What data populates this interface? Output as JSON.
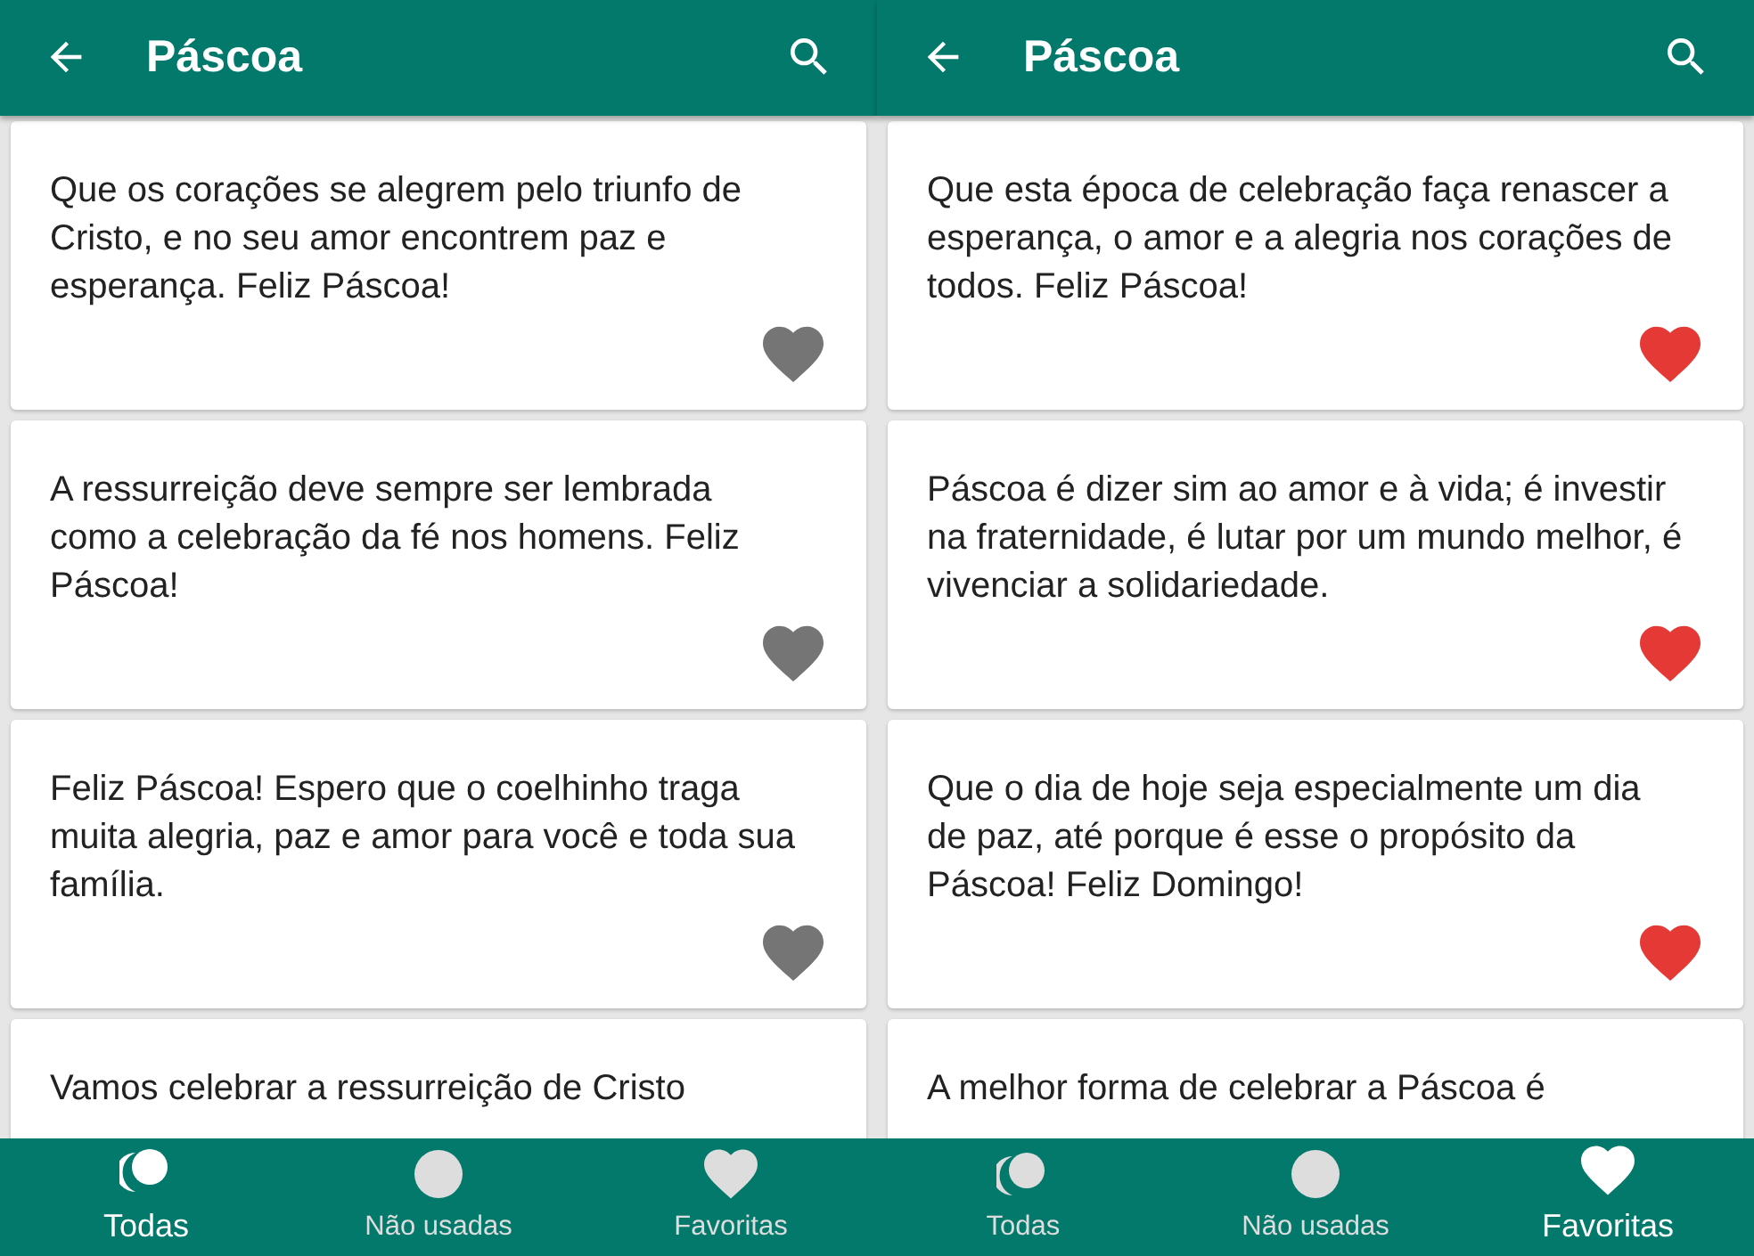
{
  "screens": [
    {
      "title": "Páscoa",
      "cards": [
        {
          "text": "Que os corações se alegrem pelo triunfo de Cristo, e no seu amor encontrem paz e esperança. Feliz Páscoa!",
          "favorite": false
        },
        {
          "text": "A ressurreição deve sempre ser lembrada como a celebração da fé nos homens. Feliz Páscoa!",
          "favorite": false
        },
        {
          "text": "Feliz Páscoa! Espero que o coelhinho traga muita alegria, paz e amor para você e toda sua família.",
          "favorite": false
        },
        {
          "text": "Vamos celebrar a ressurreição de Cristo"
        }
      ],
      "nav": [
        {
          "label": "Todas",
          "kind": "all",
          "selected": true
        },
        {
          "label": "Não usadas",
          "kind": "unused",
          "selected": false
        },
        {
          "label": "Favoritas",
          "kind": "favorites",
          "selected": false
        }
      ]
    },
    {
      "title": "Páscoa",
      "cards": [
        {
          "text": "Que esta época de celebração faça renascer a esperança, o amor e a alegria nos corações de todos. Feliz Páscoa!",
          "favorite": true
        },
        {
          "text": "Páscoa é dizer sim ao amor e à vida; é investir na fraternidade, é lutar por um mundo melhor, é vivenciar a solidariedade.",
          "favorite": true
        },
        {
          "text": "Que o dia de hoje seja especialmente um dia de paz, até porque é esse o propósito da Páscoa! Feliz Domingo!",
          "favorite": true
        },
        {
          "text": "A melhor forma de celebrar a Páscoa é"
        }
      ],
      "nav": [
        {
          "label": "Todas",
          "kind": "all",
          "selected": false
        },
        {
          "label": "Não usadas",
          "kind": "unused",
          "selected": false
        },
        {
          "label": "Favoritas",
          "kind": "favorites",
          "selected": true
        }
      ]
    }
  ]
}
